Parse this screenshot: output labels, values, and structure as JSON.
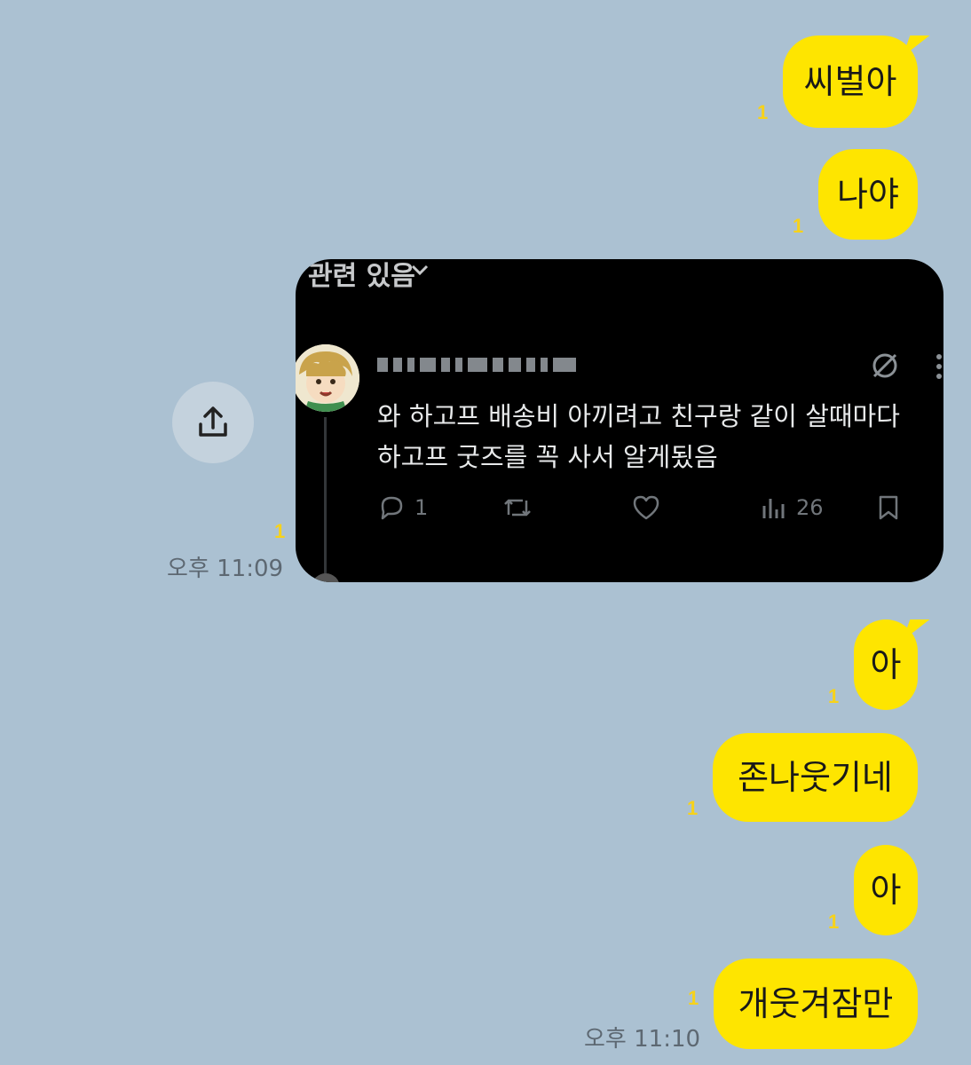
{
  "messages": [
    {
      "text": "씨벌아",
      "unread": "1"
    },
    {
      "text": "나야",
      "unread": "1"
    },
    {
      "text": "아",
      "unread": "1"
    },
    {
      "text": "존나웃기네",
      "unread": "1"
    },
    {
      "text": "아",
      "unread": "1"
    },
    {
      "text": "개웃겨잠만",
      "unread": "1"
    }
  ],
  "shared_post": {
    "header": "관련 있음",
    "text_line1": "와 하고프 배송비 아끼려고 친구랑 같이 살때마다",
    "text_line2": "하고프 굿즈를 꼭 사서 알게됬음",
    "reply_count": "1",
    "view_count": "26",
    "unread": "1",
    "time": "오후 11:09"
  },
  "last_time": "오후 11:10",
  "colors": {
    "background": "#abc1d2",
    "bubble": "#fee500",
    "unread": "#f7d21a"
  },
  "icons": [
    "share-icon",
    "reply-icon",
    "retweet-icon",
    "like-icon",
    "views-icon",
    "bookmark-icon",
    "mute-icon"
  ]
}
